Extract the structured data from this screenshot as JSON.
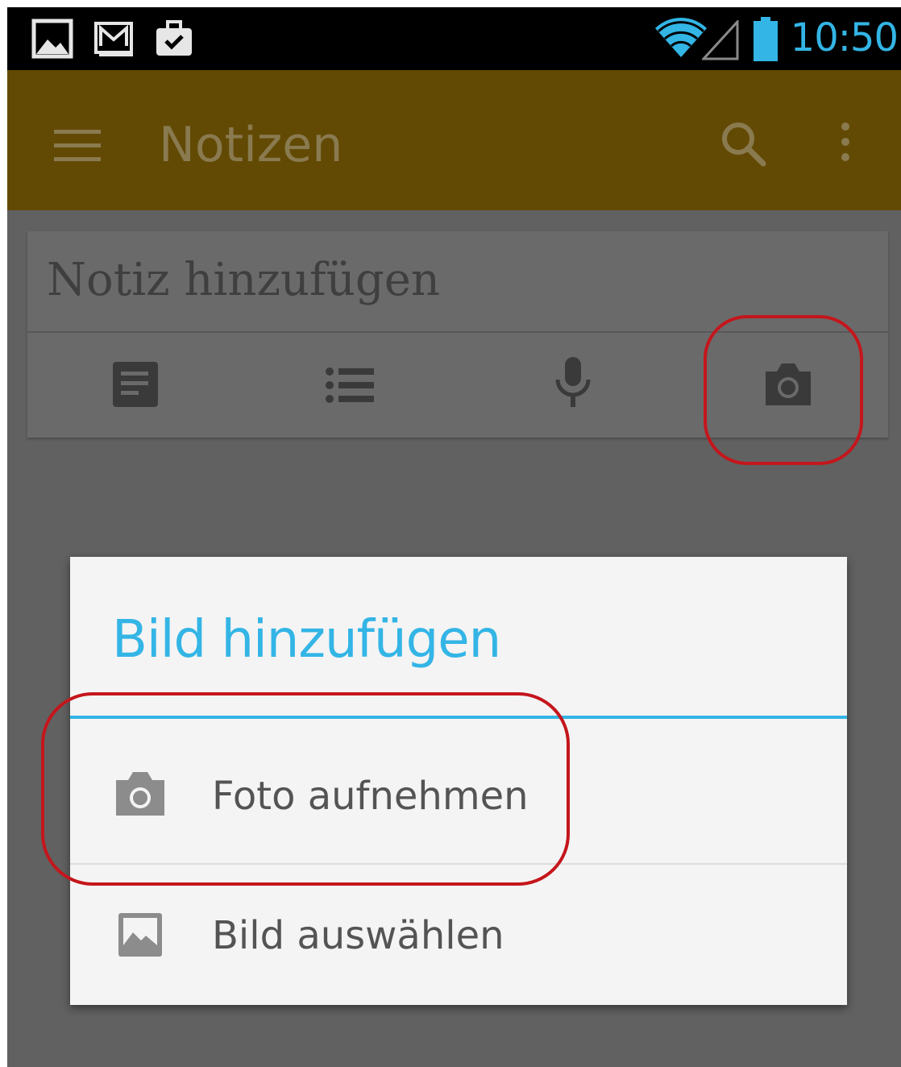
{
  "status_bar": {
    "time": "10:50",
    "left_icons": [
      "gallery-icon",
      "gmail-icon",
      "briefcase-check-icon"
    ],
    "right_icons": [
      "wifi-icon",
      "cell-signal-icon",
      "battery-icon"
    ],
    "accent": "#33b5e5"
  },
  "action_bar": {
    "title": "Notizen",
    "icons": [
      "hamburger-menu-icon",
      "search-icon",
      "overflow-menu-icon"
    ],
    "color": "#624a05"
  },
  "note_card": {
    "placeholder": "Notiz hinzufügen",
    "tools": [
      "text-note-icon",
      "list-note-icon",
      "microphone-icon",
      "camera-icon"
    ]
  },
  "dialog": {
    "title": "Bild hinzufügen",
    "title_color": "#33b5e5",
    "items": [
      {
        "label": "Foto aufnehmen",
        "icon": "camera-icon"
      },
      {
        "label": "Bild auswählen",
        "icon": "image-icon"
      }
    ]
  },
  "highlight_color": "#c4161c"
}
